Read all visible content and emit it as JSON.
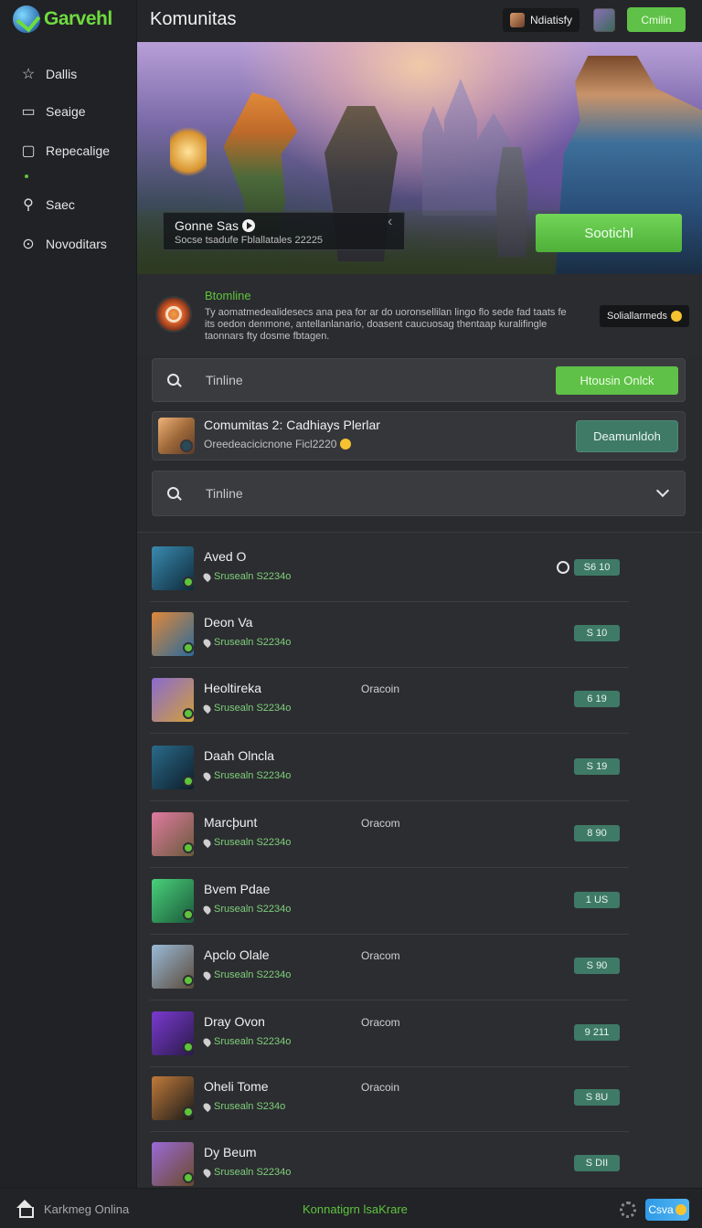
{
  "app": {
    "logo_text": "Garvehl",
    "title": "Komunitas"
  },
  "sidebar": {
    "items": [
      {
        "label": "Dallis",
        "icon": "star-icon"
      },
      {
        "label": "Seaige",
        "icon": "inbox-icon"
      },
      {
        "label": "Repecalige",
        "icon": "chat-icon"
      },
      {
        "label": "Saec",
        "icon": "wrench-icon"
      },
      {
        "label": "Novoditars",
        "icon": "info-icon"
      }
    ]
  },
  "header": {
    "notification_label": "Ndiatisfy",
    "action_button": "Cmilin"
  },
  "hero": {
    "card_title": "Gonne Sas",
    "card_subtitle": "Socse tsadufe Fblallatales 22225",
    "button_label": "Sootichl"
  },
  "info": {
    "title": "Btomline",
    "description": "Ty aomatmedealidesecs ana pea for ar do uoronsellilan lingo flo sede fad taats fe its oedon denmone, antellanlanario, doasent caucuosag thentaap kuralifingle taonnars fty dosme fbtagen.",
    "badge_label": "Soliallarmeds"
  },
  "search1": {
    "placeholder": "Tinline",
    "button_label": "Htousin Onlck"
  },
  "community": {
    "title": "Comumitas 2: Cadhiays Plerlar",
    "subtitle": "Oreedeacicicnone Ficl2220",
    "button_label": "Deamunldoh"
  },
  "search2": {
    "placeholder": "Tinline"
  },
  "members": [
    {
      "name": "Aved O",
      "sub": "Srusealn S2234o",
      "status": "",
      "stat": "S6  10",
      "colors": [
        "#3a8ab0",
        "#0e2a3a"
      ]
    },
    {
      "name": "Deon Va",
      "sub": "Srusealn S2234o",
      "status": "",
      "stat": "S  10",
      "colors": [
        "#e0883a",
        "#2a6a9a"
      ]
    },
    {
      "name": "Heoltireka",
      "sub": "Srusealn S2234o",
      "status": "Oracoin",
      "stat": "6  19",
      "colors": [
        "#8a6ad0",
        "#d0a03a"
      ]
    },
    {
      "name": "Daah Olncla",
      "sub": "Srusealn S2234o",
      "status": "",
      "stat": "S  19",
      "colors": [
        "#2a6a8a",
        "#0e1e2a"
      ]
    },
    {
      "name": "Marcþunt",
      "sub": "Srusealn S2234o",
      "status": "Oracom",
      "stat": "8  90",
      "colors": [
        "#e07aa0",
        "#6a5a3a"
      ]
    },
    {
      "name": "Bvem Pdae",
      "sub": "Srusealn S2234o",
      "status": "",
      "stat": "1  US",
      "colors": [
        "#4ad07a",
        "#1a5a3a"
      ]
    },
    {
      "name": "Apclo Olale",
      "sub": "Srusealn S2234o",
      "status": "Oracom",
      "stat": "S  90",
      "colors": [
        "#9abad8",
        "#5a4a3a"
      ]
    },
    {
      "name": "Dray Ovon",
      "sub": "Srusealn S2234o",
      "status": "Oracom",
      "stat": "9  211",
      "colors": [
        "#7a3ad0",
        "#2a1a4a"
      ]
    },
    {
      "name": "Oheli Tome",
      "sub": "Srusealn S234o",
      "status": "Oracoin",
      "stat": "S  8U",
      "colors": [
        "#c07a3a",
        "#1a1a1a"
      ]
    },
    {
      "name": "Dy Beum",
      "sub": "Srusealn S2234o",
      "status": "",
      "stat": "S  DII",
      "colors": [
        "#9a6ad8",
        "#6a4a2a"
      ]
    }
  ],
  "footer": {
    "left_label": "Karkmeg Onlina",
    "center_label": "Konnatigrn lsaKrare",
    "button_label": "Csva"
  }
}
